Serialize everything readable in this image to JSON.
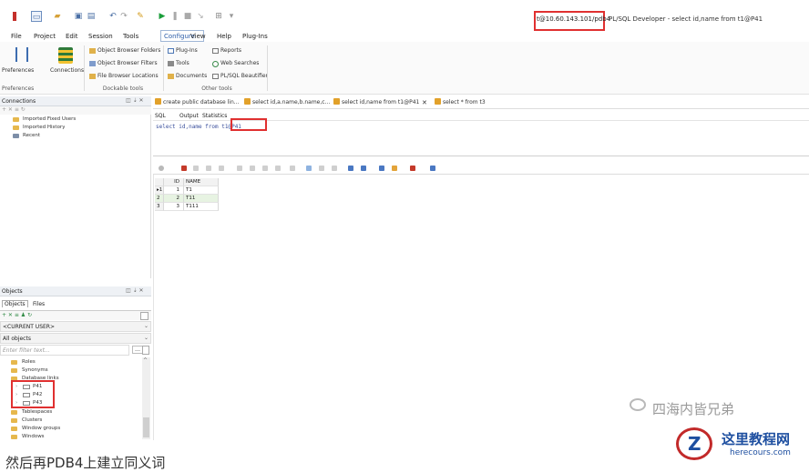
{
  "titlebar": {
    "connection": "t@10.60.143.101/pdb4",
    "app_title": "PL/SQL Developer - select id,name from t1@P41"
  },
  "menu": [
    "File",
    "Project",
    "Edit",
    "Session",
    "Tools",
    "Configure",
    "View",
    "Help",
    "Plug-Ins"
  ],
  "ribbon": {
    "preferences": "Preferences",
    "connections": "Connections",
    "object_browser_folders": "Object Browser Folders",
    "object_browser_filters": "Object Browser Filters",
    "file_browser_locations": "File Browser Locations",
    "plug_ins": "Plug-Ins",
    "tools": "Tools",
    "documents": "Documents",
    "reports": "Reports",
    "web_searches": "Web Searches",
    "plsql_beautifier": "PL/SQL Beautifier",
    "group_preferences": "Preferences",
    "group_dockable": "Dockable tools",
    "group_other": "Other tools"
  },
  "connections_panel": {
    "title": "Connections",
    "items": [
      "Imported Fixed Users",
      "Imported History",
      "Recent"
    ]
  },
  "objects_panel": {
    "title": "Objects",
    "tabs": [
      "Objects",
      "Files"
    ],
    "user": "<CURRENT USER>",
    "filter": "All objects",
    "search_placeholder": "Enter filter text...",
    "tree": [
      "Roles",
      "Synonyms",
      "Database links",
      "P41",
      "P42",
      "P43",
      "Tablespaces",
      "Clusters",
      "Window groups",
      "Windows"
    ]
  },
  "editor": {
    "tabs": [
      "create public database lin...",
      "select id,a.name,b.name,c...",
      "select id,name from t1@P41",
      "select * from t3"
    ],
    "subtabs": [
      "SQL",
      "Output",
      "Statistics"
    ],
    "sql_text": "select id,name from t1@P41"
  },
  "results": {
    "columns": [
      "ID",
      "NAME"
    ],
    "rows": [
      {
        "n": "1",
        "id": "1",
        "name": "T1"
      },
      {
        "n": "2",
        "id": "2",
        "name": "T11"
      },
      {
        "n": "3",
        "id": "3",
        "name": "T111"
      }
    ]
  },
  "watermark": {
    "wechat": "四海内皆兄弟",
    "logo_cn": "这里教程网",
    "logo_url": "herecours.com"
  },
  "caption": "然后再PDB4上建立同义词"
}
